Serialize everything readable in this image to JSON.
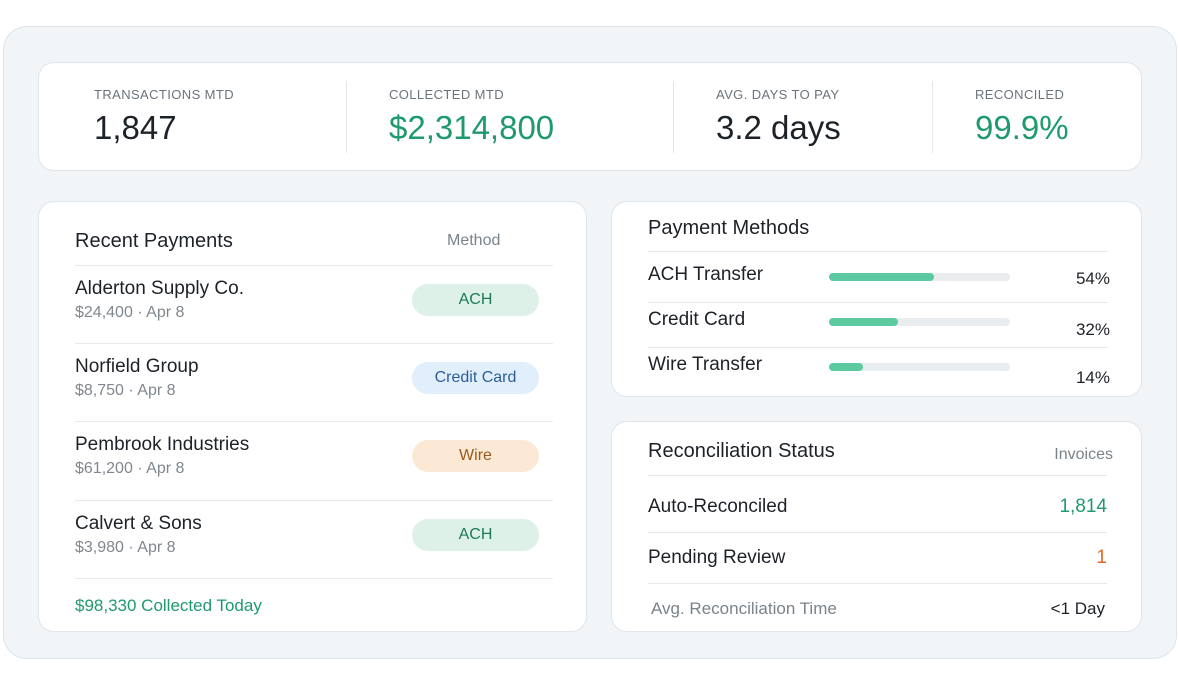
{
  "kpis": [
    {
      "label": "TRANSACTIONS MTD",
      "value": "1,847",
      "accent": "default"
    },
    {
      "label": "COLLECTED MTD",
      "value": "$2,314,800",
      "accent": "green"
    },
    {
      "label": "AVG. DAYS TO PAY",
      "value": "3.2 days",
      "accent": "default"
    },
    {
      "label": "RECONCILED",
      "value": "99.9%",
      "accent": "green"
    }
  ],
  "payments": {
    "title": "Recent Payments",
    "column": "Method",
    "rows": [
      {
        "name": "Alderton Supply Co.",
        "meta": "$24,400 · Apr 8",
        "method": "ACH",
        "method_kind": "ach"
      },
      {
        "name": "Norfield Group",
        "meta": "$8,750 · Apr 8",
        "method": "Credit Card",
        "method_kind": "cc"
      },
      {
        "name": "Pembrook Industries",
        "meta": "$61,200 · Apr 8",
        "method": "Wire",
        "method_kind": "wire"
      },
      {
        "name": "Calvert & Sons",
        "meta": "$3,980 · Apr 8",
        "method": "ACH",
        "method_kind": "ach"
      }
    ],
    "footer": "$98,330 Collected Today"
  },
  "methods": {
    "title": "Payment Methods",
    "rows": [
      {
        "label": "ACH Transfer",
        "pct": "54%",
        "share": 0.58
      },
      {
        "label": "Credit Card",
        "pct": "32%",
        "share": 0.38
      },
      {
        "label": "Wire Transfer",
        "pct": "14%",
        "share": 0.19
      }
    ]
  },
  "reconciliation": {
    "title": "Reconciliation Status",
    "column": "Invoices",
    "rows": [
      {
        "label": "Auto-Reconciled",
        "value": "1,814",
        "tone": "green"
      },
      {
        "label": "Pending Review",
        "value": "1",
        "tone": "orange"
      }
    ],
    "footer_label": "Avg. Reconciliation Time",
    "footer_value": "<1 Day"
  },
  "colors": {
    "green": "#1e9a6c",
    "bar": "#5ccaa0",
    "orange": "#e0692a",
    "frame": "#f1f5f8"
  }
}
